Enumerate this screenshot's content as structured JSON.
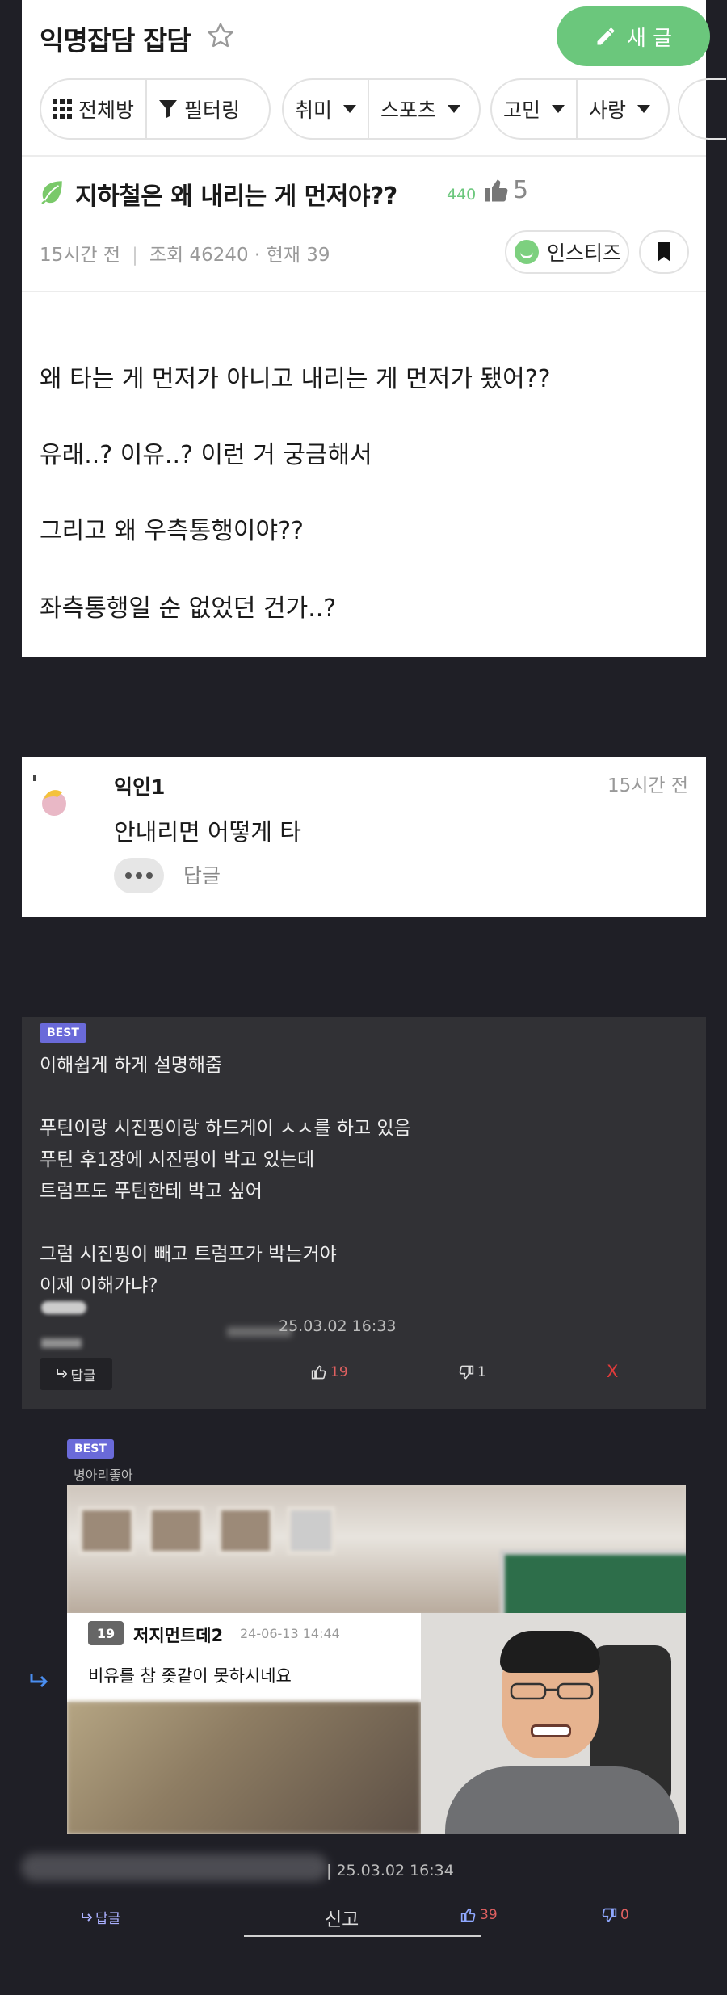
{
  "header": {
    "board_title": "익명잡담 잡담",
    "new_post_label": "새 글"
  },
  "filters": {
    "all_rooms": "전체방",
    "filtering": "필터링",
    "hobby": "취미",
    "sports": "스포츠",
    "worry": "고민",
    "love": "사랑"
  },
  "post": {
    "title": "지하철은 왜 내리는 게 먼저야??",
    "title_views": "440",
    "likes": "5",
    "time": "15시간 전",
    "views": "조회 46240",
    "current": "현재 39",
    "author_chip": "인스티즈",
    "body": [
      "왜 타는 게 먼저가 아니고 내리는 게 먼저가 됐어??",
      "유래..? 이유..? 이런 거 궁금해서",
      "그리고 왜 우측통행이야??",
      "좌측통행일 순 없었던 건가..?"
    ]
  },
  "comment1": {
    "author": "익인1",
    "time": "15시간 전",
    "text": "안내리면 어떻게 타",
    "reply_label": "답글"
  },
  "best_comment": {
    "badge": "BEST",
    "lines": [
      "이해쉽게 하게 설명해줌",
      "푸틴이랑 시진핑이랑 하드게이 ㅅㅅ를 하고 있음",
      "푸틴 후1장에 시진핑이 박고 있는데",
      "트럼프도 푸틴한테 박고 싶어",
      "그럼 시진핑이 빼고 트럼프가 박는거야",
      "이제 이해가냐?"
    ],
    "datetime": "25.03.02 16:33",
    "reply_label": "답글",
    "likes": "19",
    "dislikes": "1",
    "close": "X"
  },
  "best_reply": {
    "badge": "BEST",
    "author": "병아리좋아",
    "meme": {
      "id_icon": "19",
      "name": "저지먼트데2",
      "date": "24-06-13 14:44",
      "text": "비유를 참 좆같이 못하시네요"
    },
    "datetime": "| 25.03.02 16:34",
    "reply_label": "답글",
    "report_label": "신고",
    "likes": "39",
    "dislikes": "0"
  },
  "colors": {
    "accent_green": "#6bc77c",
    "best_badge": "#6a6ad9",
    "like_red": "#e06060",
    "page_bg": "#1f1f26"
  }
}
